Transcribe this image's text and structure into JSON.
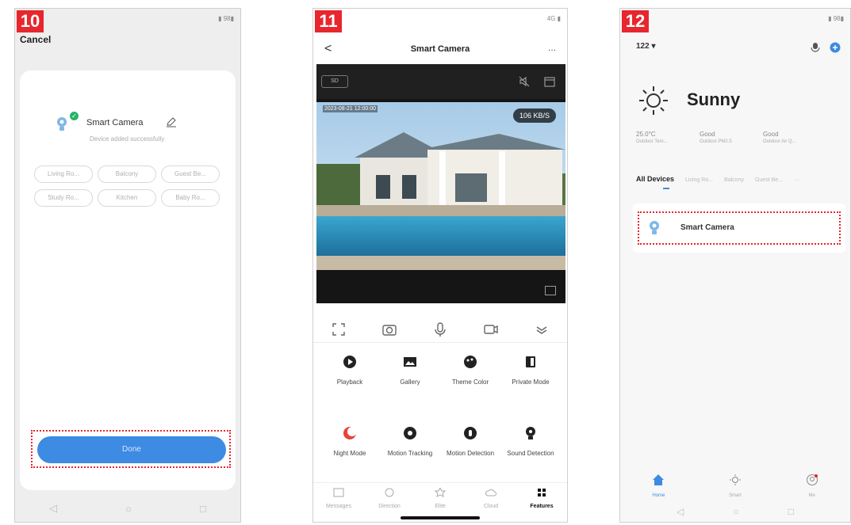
{
  "colors": {
    "accent_blue": "#3d8be3",
    "badge_red": "#e8262d",
    "success_green": "#27b36a"
  },
  "step10": {
    "badge": "10",
    "cancel": "Cancel",
    "device_name": "Smart Camera",
    "device_status": "Device added successfully",
    "rooms": [
      "Living Ro...",
      "Balcony",
      "Guest Be...",
      "Study Ro...",
      "Kitchen",
      "Baby Ro..."
    ],
    "done": "Done",
    "nav_icons": [
      "back-triangle-icon",
      "home-circle-icon",
      "recent-square-icon"
    ]
  },
  "step11": {
    "badge": "11",
    "status_right": "4G",
    "back": "<",
    "title": "Smart Camera",
    "more": "...",
    "sd_badge": "SD",
    "timestamp": "2023-08-21 12:00:00",
    "bitrate": "106 KB/S",
    "controls": [
      "screenshot-icon",
      "camera-icon",
      "microphone-icon",
      "record-icon",
      "expand-icon"
    ],
    "features": [
      {
        "label": "Playback",
        "icon": "playback-icon"
      },
      {
        "label": "Gallery",
        "icon": "gallery-icon"
      },
      {
        "label": "Theme Color",
        "icon": "palette-icon"
      },
      {
        "label": "Private Mode",
        "icon": "private-mode-icon"
      },
      {
        "label": "Night Mode",
        "icon": "night-mode-icon"
      },
      {
        "label": "Motion Tracking",
        "icon": "motion-tracking-icon"
      },
      {
        "label": "Motion Detection",
        "icon": "motion-detection-icon"
      },
      {
        "label": "Sound Detection",
        "icon": "sound-detection-icon"
      }
    ],
    "tabs": [
      {
        "label": "Messages",
        "active": false
      },
      {
        "label": "Direction",
        "active": false
      },
      {
        "label": "Elite",
        "active": false
      },
      {
        "label": "Cloud",
        "active": false
      },
      {
        "label": "Features",
        "active": true
      }
    ]
  },
  "step12": {
    "badge": "12",
    "location": "122 ▾",
    "weather": "Sunny",
    "stats": [
      {
        "value": "25.0°C",
        "label": "Outdoor Tem..."
      },
      {
        "value": "Good",
        "label": "Outdoor PM2.5"
      },
      {
        "value": "Good",
        "label": "Outdoor Air Q..."
      }
    ],
    "tabs": [
      "All Devices",
      "Living Ro...",
      "Balcony",
      "Guest Be...",
      "···"
    ],
    "device_name": "Smart Camera",
    "bottom_tabs": [
      {
        "label": "Home",
        "active": true
      },
      {
        "label": "Smart",
        "active": false
      },
      {
        "label": "Me",
        "active": false
      }
    ],
    "nav_icons": [
      "back-triangle-icon",
      "home-circle-icon",
      "recent-square-icon"
    ]
  }
}
